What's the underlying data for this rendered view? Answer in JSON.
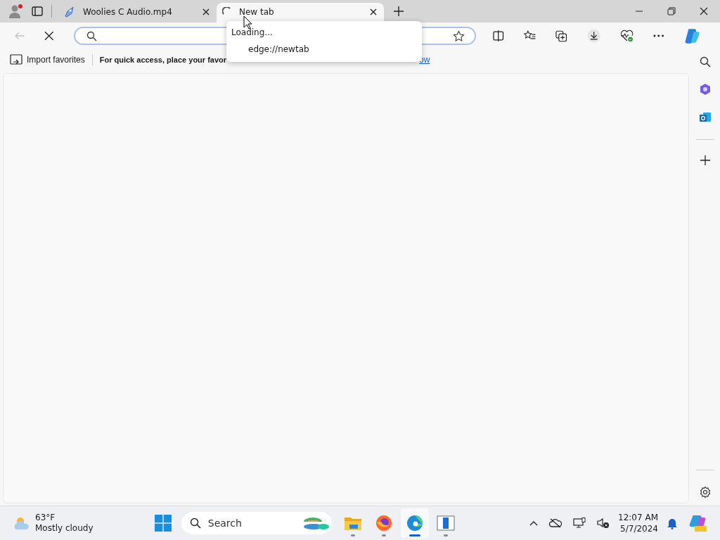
{
  "tabs": [
    {
      "title": "Woolies C Audio.mp4",
      "selected": false,
      "loading": false
    },
    {
      "title": "New tab",
      "selected": true,
      "loading": true
    }
  ],
  "tab_popup": {
    "status": "Loading...",
    "url": "edge://newtab"
  },
  "favorites_bar": {
    "import_label": "Import favorites",
    "hint": "For quick access, place your favor",
    "link": "ow"
  },
  "taskbar": {
    "weather": {
      "temperature": "63°F",
      "condition": "Mostly cloudy"
    },
    "search": {
      "placeholder": "Search"
    },
    "apps": [
      {
        "kind": "files",
        "active": false
      },
      {
        "kind": "firefox",
        "active": false
      },
      {
        "kind": "edge",
        "active": true
      },
      {
        "kind": "window",
        "active": false
      }
    ],
    "clock": {
      "time": "12:07 AM",
      "date": "5/7/2024"
    }
  }
}
